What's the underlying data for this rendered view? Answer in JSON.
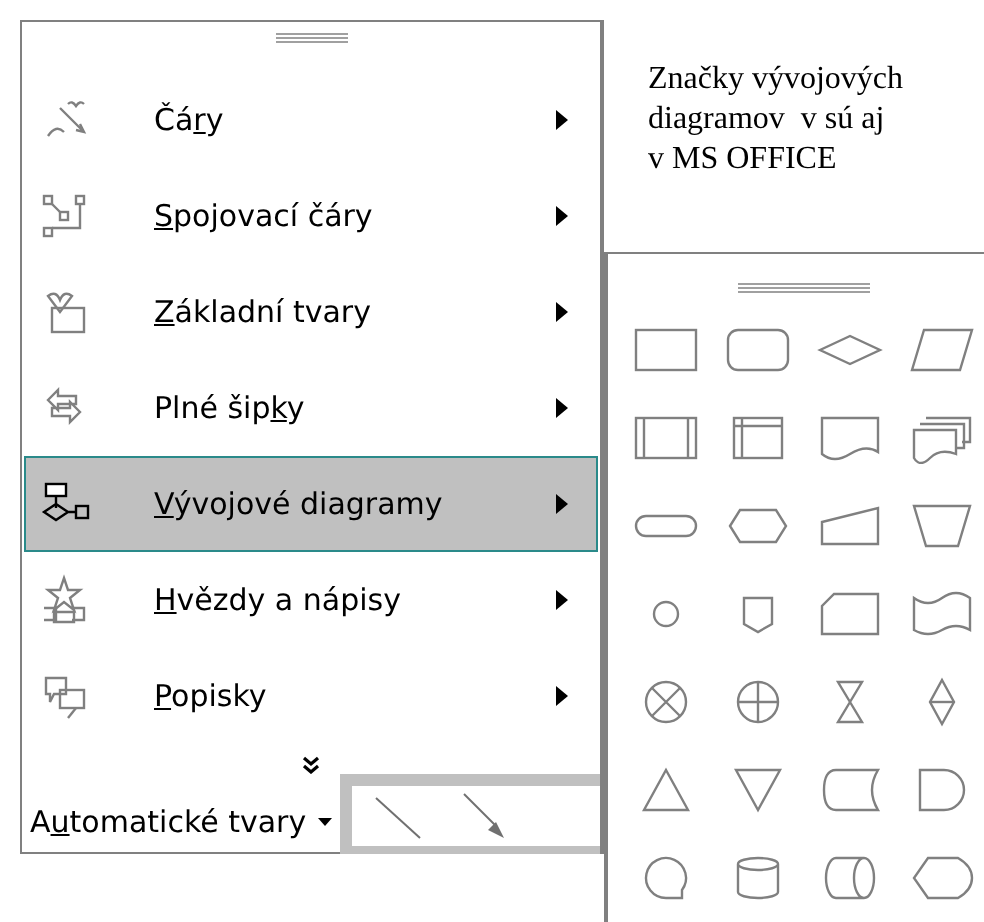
{
  "menu": {
    "items": [
      {
        "kind": "lines",
        "pre": "Čá",
        "key": "r",
        "post": "y",
        "selected": false
      },
      {
        "kind": "connectors",
        "key": "S",
        "post": "pojovací čáry",
        "selected": false
      },
      {
        "kind": "basic",
        "key": "Z",
        "post": "ákladní tvary",
        "selected": false
      },
      {
        "kind": "arrows",
        "pre": "Plné šip",
        "key": "k",
        "post": "y",
        "selected": false
      },
      {
        "kind": "flowchart",
        "key": "V",
        "post": "ývojové diagramy",
        "selected": true
      },
      {
        "kind": "stars",
        "key": "H",
        "post": "vězdy a nápisy",
        "selected": false
      },
      {
        "kind": "callouts",
        "key": "P",
        "post": "opisky",
        "selected": false
      }
    ]
  },
  "toolbar": {
    "autoshapes": {
      "pre": "A",
      "key": "u",
      "post": "tomatické tvary"
    }
  },
  "note": {
    "lines": [
      "Značky vývojových",
      "diagramov  v sú aj",
      "v MS OFFICE"
    ]
  },
  "palette": {
    "shapes": [
      {
        "kind": "process"
      },
      {
        "kind": "alternate"
      },
      {
        "kind": "decision"
      },
      {
        "kind": "data"
      },
      {
        "kind": "predefined"
      },
      {
        "kind": "internal"
      },
      {
        "kind": "document"
      },
      {
        "kind": "multidocument"
      },
      {
        "kind": "terminator"
      },
      {
        "kind": "preparation"
      },
      {
        "kind": "manual-input"
      },
      {
        "kind": "manual-operation"
      },
      {
        "kind": "connector"
      },
      {
        "kind": "offpage"
      },
      {
        "kind": "card"
      },
      {
        "kind": "tape"
      },
      {
        "kind": "summing"
      },
      {
        "kind": "or"
      },
      {
        "kind": "collate"
      },
      {
        "kind": "sort"
      },
      {
        "kind": "extract"
      },
      {
        "kind": "merge"
      },
      {
        "kind": "stored-data"
      },
      {
        "kind": "delay"
      },
      {
        "kind": "sequential"
      },
      {
        "kind": "disk"
      },
      {
        "kind": "direct-access"
      },
      {
        "kind": "display"
      }
    ]
  }
}
